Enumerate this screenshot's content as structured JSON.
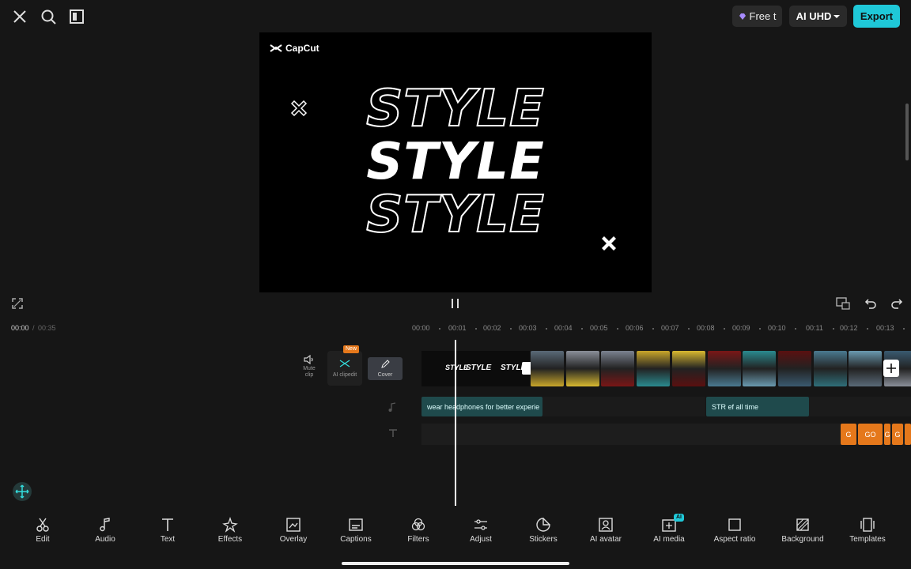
{
  "topbar": {
    "free_label": "Free t",
    "quality_label": "AI UHD",
    "export_label": "Export"
  },
  "preview": {
    "brand": "CapCut",
    "words": [
      "STYLE",
      "STYLE",
      "STYLE"
    ]
  },
  "timeline": {
    "current_time": "00:00",
    "total_time": "00:35",
    "ticks": [
      "00:00",
      "00:01",
      "00:02",
      "00:03",
      "00:04",
      "00:05",
      "00:06",
      "00:07",
      "00:08",
      "00:09",
      "00:10",
      "00:11",
      "00:12",
      "00:13"
    ]
  },
  "track_controls": {
    "mute_label": "Mute clip",
    "ai_badge": "New",
    "ai_label": "AI clipedit",
    "cover_label": "Cover"
  },
  "audio_clips": [
    {
      "label": "wear headphones for better experie"
    },
    {
      "label": "STR  ef    all time"
    }
  ],
  "text_clips": [
    "G",
    "GO",
    "G",
    "G"
  ],
  "toolbar": {
    "items": [
      {
        "label": "Edit",
        "icon": "scissors-icon"
      },
      {
        "label": "Audio",
        "icon": "music-note-icon"
      },
      {
        "label": "Text",
        "icon": "text-icon"
      },
      {
        "label": "Effects",
        "icon": "sparkle-icon"
      },
      {
        "label": "Overlay",
        "icon": "overlay-icon"
      },
      {
        "label": "Captions",
        "icon": "captions-icon"
      },
      {
        "label": "Filters",
        "icon": "filters-icon"
      },
      {
        "label": "Adjust",
        "icon": "sliders-icon"
      },
      {
        "label": "Stickers",
        "icon": "sticker-icon"
      },
      {
        "label": "AI avatar",
        "icon": "avatar-icon"
      },
      {
        "label": "AI media",
        "icon": "ai-media-icon",
        "badge": "AI"
      },
      {
        "label": "Aspect ratio",
        "icon": "aspect-ratio-icon"
      },
      {
        "label": "Background",
        "icon": "background-icon"
      },
      {
        "label": "Templates",
        "icon": "templates-icon"
      }
    ]
  },
  "colors": {
    "accent": "#1fc8d8",
    "background": "#161616",
    "text_clip": "#e5781b",
    "audio_clip": "#1f4a4c"
  }
}
